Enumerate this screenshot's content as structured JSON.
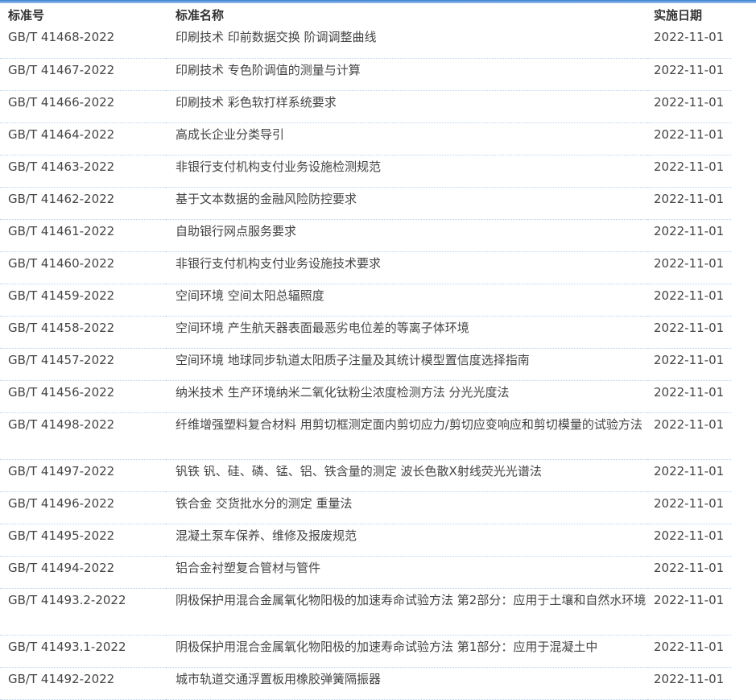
{
  "table": {
    "headers": {
      "number": "标准号",
      "name": "标准名称",
      "date": "实施日期"
    },
    "rows": [
      {
        "number": "GB/T 41468-2022",
        "name": "印刷技术 印前数据交换 阶调调整曲线",
        "date": "2022-11-01"
      },
      {
        "number": "GB/T 41467-2022",
        "name": "印刷技术 专色阶调值的测量与计算",
        "date": "2022-11-01"
      },
      {
        "number": "GB/T 41466-2022",
        "name": "印刷技术 彩色软打样系统要求",
        "date": "2022-11-01"
      },
      {
        "number": "GB/T 41464-2022",
        "name": "高成长企业分类导引",
        "date": "2022-11-01"
      },
      {
        "number": "GB/T 41463-2022",
        "name": "非银行支付机构支付业务设施检测规范",
        "date": "2022-11-01"
      },
      {
        "number": "GB/T 41462-2022",
        "name": "基于文本数据的金融风险防控要求",
        "date": "2022-11-01"
      },
      {
        "number": "GB/T 41461-2022",
        "name": "自助银行网点服务要求",
        "date": "2022-11-01"
      },
      {
        "number": "GB/T 41460-2022",
        "name": "非银行支付机构支付业务设施技术要求",
        "date": "2022-11-01"
      },
      {
        "number": "GB/T 41459-2022",
        "name": "空间环境 空间太阳总辐照度",
        "date": "2022-11-01"
      },
      {
        "number": "GB/T 41458-2022",
        "name": "空间环境 产生航天器表面最恶劣电位差的等离子体环境",
        "date": "2022-11-01"
      },
      {
        "number": "GB/T 41457-2022",
        "name": "空间环境 地球同步轨道太阳质子注量及其统计模型置信度选择指南",
        "date": "2022-11-01"
      },
      {
        "number": "GB/T 41456-2022",
        "name": "纳米技术 生产环境纳米二氧化钛粉尘浓度检测方法 分光光度法",
        "date": "2022-11-01"
      },
      {
        "number": "GB/T 41498-2022",
        "name": "纤维增强塑料复合材料 用剪切框测定面内剪切应力/剪切应变响应和剪切模量的试验方法",
        "date": "2022-11-01"
      },
      {
        "number": "GB/T 41497-2022",
        "name": "钒铁 钒、硅、磷、锰、铝、铁含量的测定 波长色散X射线荧光光谱法",
        "date": "2022-11-01"
      },
      {
        "number": "GB/T 41496-2022",
        "name": "铁合金 交货批水分的测定 重量法",
        "date": "2022-11-01"
      },
      {
        "number": "GB/T 41495-2022",
        "name": "混凝土泵车保养、维修及报废规范",
        "date": "2022-11-01"
      },
      {
        "number": "GB/T 41494-2022",
        "name": "铝合金衬塑复合管材与管件",
        "date": "2022-11-01"
      },
      {
        "number": "GB/T 41493.2-2022",
        "name": "阴极保护用混合金属氧化物阳极的加速寿命试验方法 第2部分：应用于土壤和自然水环境",
        "date": "2022-11-01"
      },
      {
        "number": "GB/T 41493.1-2022",
        "name": "阴极保护用混合金属氧化物阳极的加速寿命试验方法 第1部分：应用于混凝土中",
        "date": "2022-11-01"
      },
      {
        "number": "GB/T 41492-2022",
        "name": "城市轨道交通浮置板用橡胶弹簧隔振器",
        "date": "2022-11-01"
      }
    ]
  }
}
